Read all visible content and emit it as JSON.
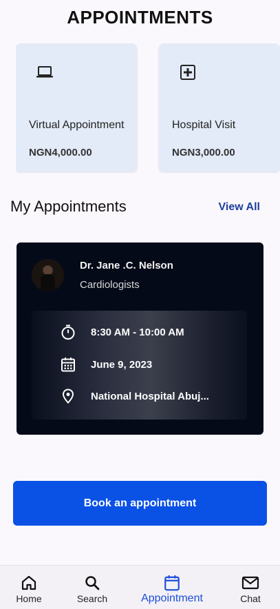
{
  "header": {
    "title": "APPOINTMENTS"
  },
  "services": [
    {
      "icon": "laptop-icon",
      "title": "Virtual Appointment",
      "price": "NGN4,000.00"
    },
    {
      "icon": "medical-plus-icon",
      "title": "Hospital Visit",
      "price": "NGN3,000.00"
    }
  ],
  "my_appointments": {
    "title": "My Appointments",
    "view_all_label": "View All"
  },
  "appointment": {
    "doctor_name": "Dr. Jane .C. Nelson",
    "specialty": "Cardiologists",
    "time": "8:30 AM - 10:00 AM",
    "date": "June 9, 2023",
    "location": "National Hospital Abuj..."
  },
  "book_button_label": "Book an appointment",
  "bottom_nav": {
    "items": [
      {
        "label": "Home",
        "icon": "home-icon"
      },
      {
        "label": "Search",
        "icon": "search-icon"
      },
      {
        "label": "Appointment",
        "icon": "calendar-icon",
        "active": true
      },
      {
        "label": "Chat",
        "icon": "mail-icon"
      }
    ]
  },
  "colors": {
    "primary": "#0a51e6",
    "active_nav": "#1d4ed8",
    "card_bg": "#e3ebf8",
    "appointment_card_bg": "#050a18"
  }
}
